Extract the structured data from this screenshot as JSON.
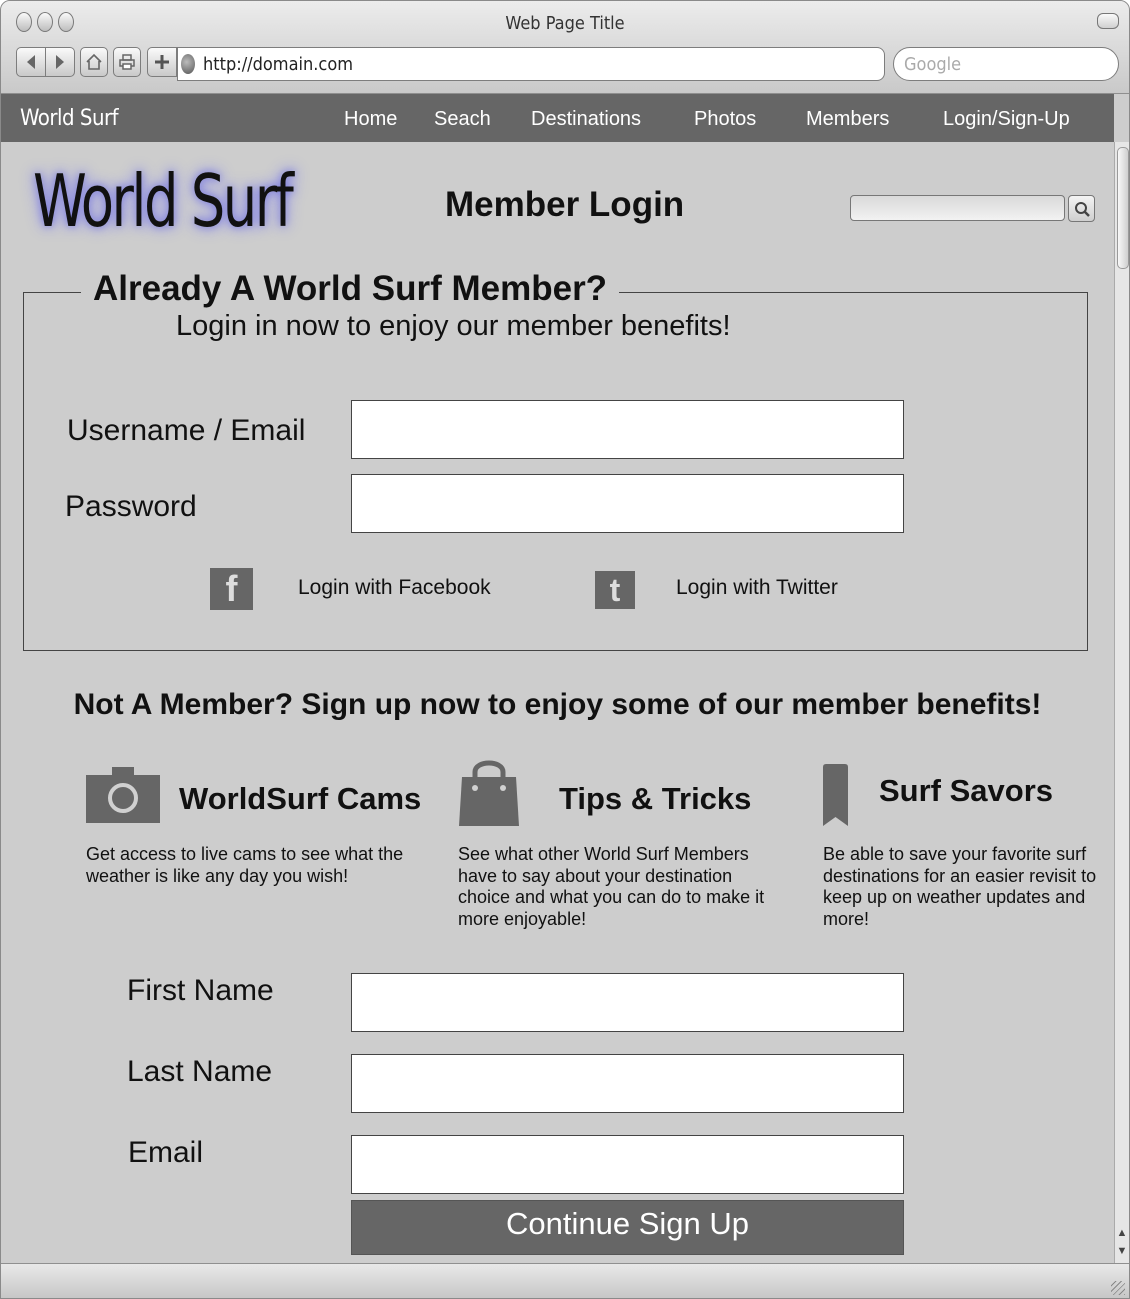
{
  "browser": {
    "window_title": "Web Page Title",
    "url": "http://domain.com",
    "search_placeholder": "Google"
  },
  "nav": {
    "brand": "World Surf",
    "items": [
      "Home",
      "Seach",
      "Destinations",
      "Photos",
      "Members",
      "Login/Sign-Up"
    ]
  },
  "header": {
    "logo_text": "World Surf",
    "page_title": "Member Login"
  },
  "login": {
    "heading": "Already A World Surf Member?",
    "subheading": "Login in now to enjoy our member benefits!",
    "username_label": "Username / Email",
    "password_label": "Password",
    "facebook_label": "Login with Facebook",
    "twitter_label": "Login with Twitter"
  },
  "signup": {
    "heading": "Not A Member? Sign up now to enjoy some of our member benefits!",
    "features": [
      {
        "title": "WorldSurf Cams",
        "desc": "Get access to live cams to see what the weather is like any day you wish!",
        "icon": "camera-icon"
      },
      {
        "title": "Tips & Tricks",
        "desc": "See what other World Surf Members have to say about your destination choice and what you can do to make it more enjoyable!",
        "icon": "shopping-bag-icon"
      },
      {
        "title": "Surf Savors",
        "desc": "Be able to save your favorite surf destinations for an easier revisit to keep up on weather updates and more!",
        "icon": "bookmark-icon"
      }
    ],
    "first_name_label": "First Name",
    "last_name_label": "Last Name",
    "email_label": "Email",
    "submit_label": "Continue Sign Up"
  }
}
